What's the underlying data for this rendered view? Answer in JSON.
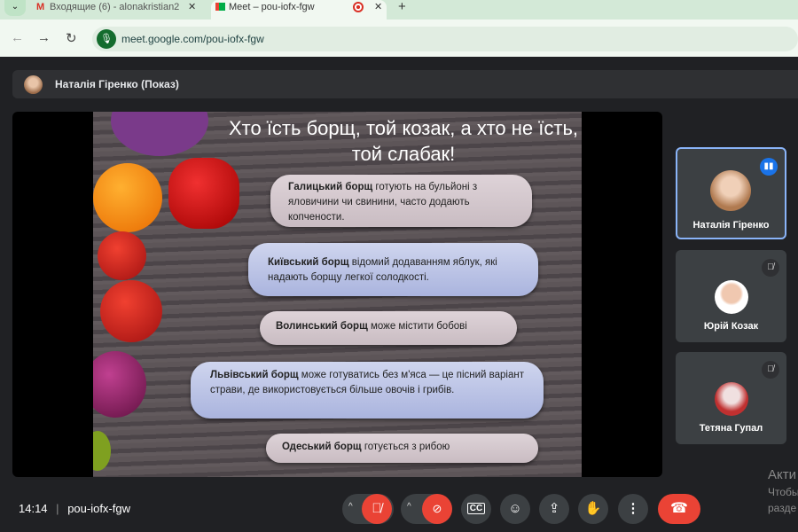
{
  "browser": {
    "tabs": [
      {
        "label": "Входящие (6) - alonakristian2@",
        "icon": "gmail-icon"
      },
      {
        "label": "Meet – pou-iofx-fgw",
        "icon": "meet-icon"
      }
    ],
    "new_tab": "+",
    "url": "meet.google.com/pou-iofx-fgw"
  },
  "presenter": {
    "name": "Наталія Гіренко (Показ)"
  },
  "slide": {
    "title": "Хто їсть борщ, той козак, а хто не їсть, той слабак!",
    "items": [
      {
        "bold": "Галицький борщ",
        "text": " готують на бульйоні з яловичини чи свинини, часто додають копчености."
      },
      {
        "bold": "Київський борщ",
        "text": " відомий додаванням яблук, які надають борщу легкої солодкості."
      },
      {
        "bold": "Волинський борщ",
        "text": " може містити бобові"
      },
      {
        "bold": "Львівський борщ",
        "text": " може готуватись без м'яса — це пісний варіант страви, де використовується більше овочів і грибів."
      },
      {
        "bold": "Одеський борщ",
        "text": " готується з рибою"
      }
    ]
  },
  "participants": [
    {
      "name": "Наталія Гіренко",
      "speaking": true
    },
    {
      "name": "Юрій Козак",
      "muted": true
    },
    {
      "name": "Тетяна Гупал",
      "muted": true
    }
  ],
  "watermark": [
    "Акти",
    "Чтобы",
    "разде"
  ],
  "meeting": {
    "time": "14:14",
    "code": "pou-iofx-fgw"
  },
  "colors": {
    "accent": "#1a73e8",
    "danger": "#ea4335"
  }
}
